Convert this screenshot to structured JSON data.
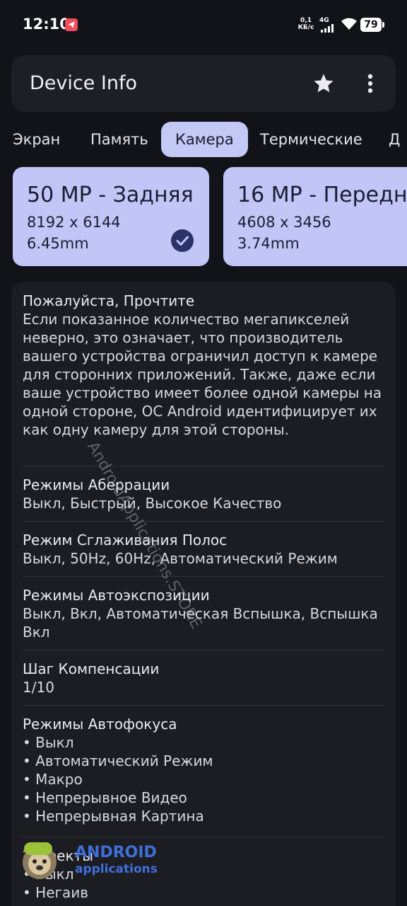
{
  "status_bar": {
    "time": "12:10",
    "speed_value": "0,1",
    "speed_unit": "КБ/с",
    "network": "4G",
    "battery": "79"
  },
  "app_bar": {
    "title": "Device Info",
    "star_icon": "star-icon",
    "more_icon": "more-vert-icon"
  },
  "tabs": [
    {
      "label": "Экран",
      "active": false
    },
    {
      "label": "Память",
      "active": false
    },
    {
      "label": "Камера",
      "active": true
    },
    {
      "label": "Термические",
      "active": false
    },
    {
      "label": "Д",
      "active": false
    }
  ],
  "cameras": [
    {
      "title": "50 MP - Задняя",
      "resolution": "8192 x 6144",
      "focal": "6.45mm",
      "selected": true
    },
    {
      "title": "16 MP - Передн",
      "resolution": "4608 x 3456",
      "focal": "3.74mm",
      "selected": false
    }
  ],
  "sections": {
    "notice": {
      "title": "Пожалуйста, Прочтите",
      "text": "Если показанное количество мегапикселей неверно, это означает, что производитель вашего устройства ограничил доступ к камере для сторонних приложений. Также, даже если ваше устройство имеет более одной камеры на одной стороне, ОС Android идентифицирует их как одну камеру для этой стороны."
    },
    "aberration": {
      "title": "Режимы Аберрации",
      "value": "Выкл, Быстрый, Высокое Качество"
    },
    "antibanding": {
      "title": "Режим Сглаживания Полос",
      "value": "Выкл, 50Hz, 60Hz, Автоматический Режим"
    },
    "autoexposure": {
      "title": "Режимы Автоэкспозиции",
      "value": "Выкл, Вкл, Автоматическая Вспышка, Вспышка Вкл"
    },
    "compensation": {
      "title": "Шаг Компенсации",
      "value": "1/10"
    },
    "autofocus": {
      "title": "Режимы Автофокуса",
      "items": [
        "Выкл",
        "Автоматический Режим",
        "Макро",
        "Непрерывное Видео",
        "Непрерывная Картина"
      ]
    },
    "effects": {
      "title": "Эффекты",
      "items": [
        "Выкл",
        "Негаив"
      ]
    }
  },
  "watermark": "AndroidApplications.STORE",
  "brand": {
    "line1": "ANDROID",
    "line2": "applications"
  }
}
